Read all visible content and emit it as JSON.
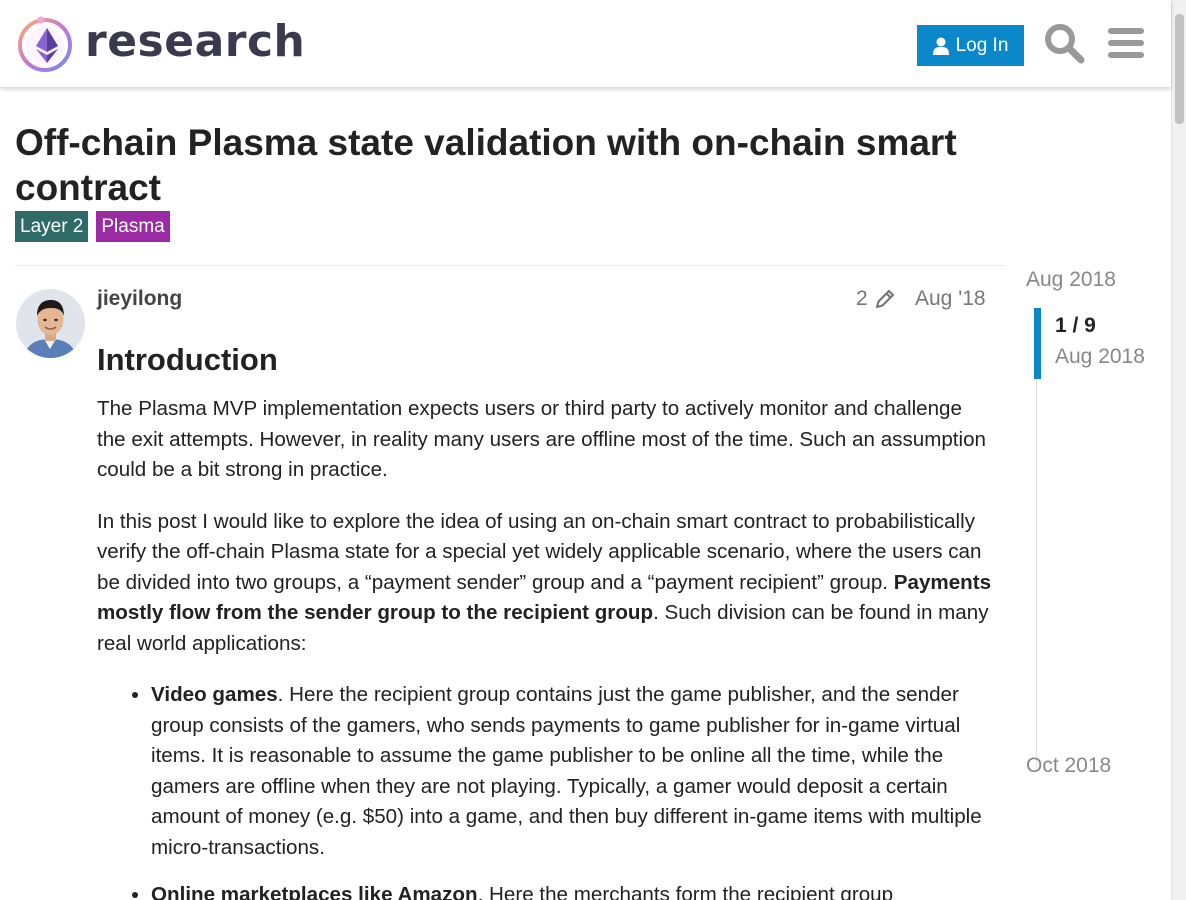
{
  "header": {
    "site_name": "research",
    "login_label": "Log In",
    "brand_color": "#0a88c9"
  },
  "topic": {
    "title": "Off-chain Plasma state validation with on-chain smart contract",
    "tags": [
      {
        "label": "Layer 2",
        "color": "#2e6a67"
      },
      {
        "label": "Plasma",
        "color": "#9b2ba5"
      }
    ]
  },
  "post": {
    "username": "jieyilong",
    "edit_count": "2",
    "date": "Aug '18",
    "heading": "Introduction",
    "para1": "The Plasma MVP implementation expects users or third party to actively monitor and challenge the exit attempts. However, in reality many users are offline most of the time. Such an assumption could be a bit strong in practice.",
    "para2_start": "In this post I would like to explore the idea of using an on-chain smart contract to probabilistically verify the off-chain Plasma state for a special yet widely applicable scenario, where the users can be divided into two groups, a “payment sender” group and a “payment recipient” group. ",
    "para2_bold": "Payments mostly flow from the sender group to the recipient group",
    "para2_end": ". Such division can be found in many real world applications:",
    "list": [
      {
        "bold": "Video games",
        "text": ". Here the recipient group contains just the game publisher, and the sender group consists of the gamers, who sends payments to game publisher for in-game virtual items. It is reasonable to assume the game publisher to be online all the time, while the gamers are offline when they are not playing. Typically, a gamer would deposit a certain amount of money (e.g. $50) into a game, and then buy different in-game items with multiple micro-transactions."
      },
      {
        "bold": "Online marketplaces like Amazon",
        "text": ". Here the merchants form the recipient group"
      }
    ]
  },
  "timeline": {
    "start_date": "Aug 2018",
    "position": "1 / 9",
    "current_date": "Aug 2018",
    "end_date": "Oct 2018"
  }
}
